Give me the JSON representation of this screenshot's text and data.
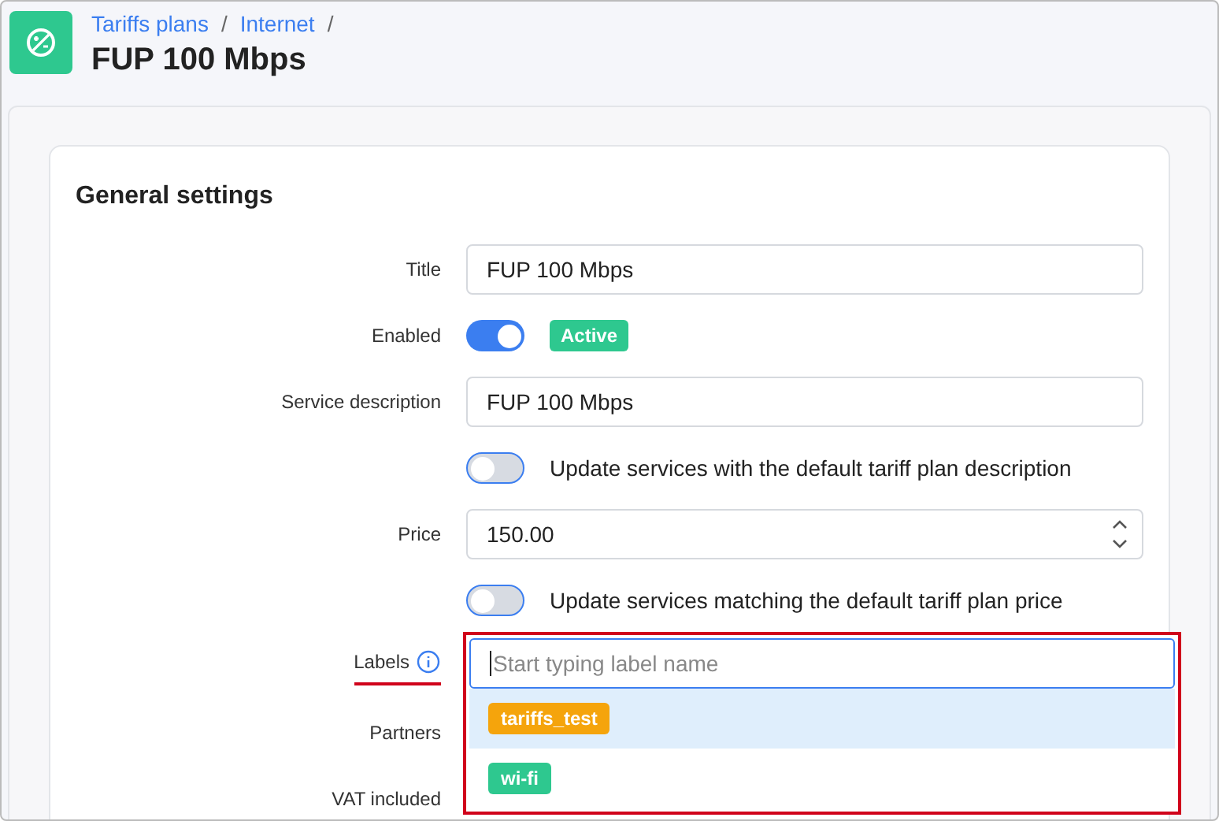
{
  "breadcrumbs": [
    {
      "label": "Tariffs plans",
      "separator": "/"
    },
    {
      "label": "Internet",
      "separator": "/"
    }
  ],
  "page_title": "FUP 100 Mbps",
  "section_title": "General settings",
  "fields": [
    {
      "kind": "text",
      "label": "Title",
      "value": "FUP 100 Mbps"
    },
    {
      "kind": "switch",
      "label": "Enabled",
      "on": true,
      "badge": "Active"
    },
    {
      "kind": "text",
      "label": "Service description",
      "value": "FUP 100 Mbps"
    },
    {
      "kind": "switch",
      "on": false,
      "text": "Update services with the default tariff plan description"
    },
    {
      "kind": "number",
      "label": "Price",
      "value": "150.00"
    },
    {
      "kind": "switch",
      "on": false,
      "text": "Update services matching the default tariff plan price"
    },
    {
      "kind": "labels",
      "label": "Labels",
      "placeholder": "Start typing label name",
      "highlighted": true,
      "options": [
        {
          "name": "tariffs_test",
          "color": "#f5a40c",
          "selected": true
        },
        {
          "name": "wi-fi",
          "color": "#2ec88f",
          "selected": false
        }
      ]
    },
    {
      "kind": "plain",
      "label": "Partners"
    },
    {
      "kind": "plain",
      "label": "VAT included"
    }
  ]
}
